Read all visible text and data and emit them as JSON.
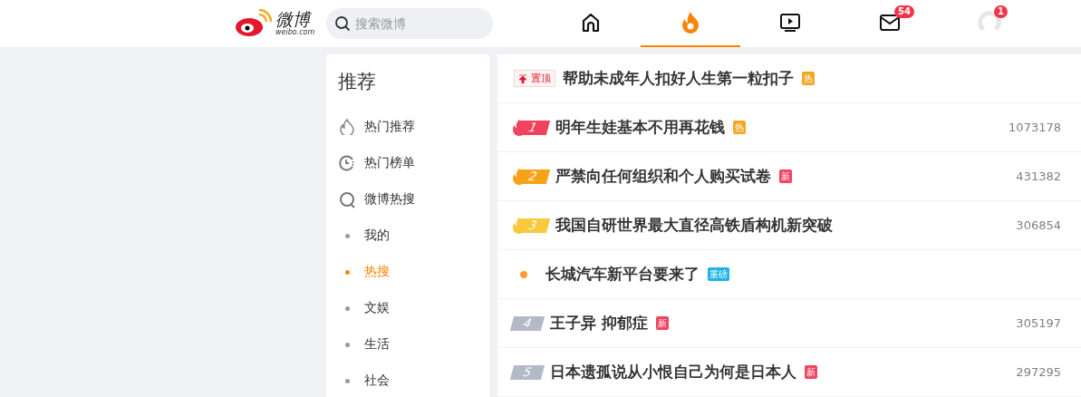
{
  "header": {
    "logo_name": "微博",
    "logo_text": "weibo.com",
    "search": {
      "placeholder": "搜索微博"
    },
    "tabs": [
      {
        "selected": false
      },
      {
        "selected": true
      },
      {
        "selected": false
      },
      {
        "selected": false,
        "badge": "54"
      },
      {
        "selected": false,
        "badge": "1"
      }
    ]
  },
  "sidebar": {
    "title": "推荐",
    "items": [
      {
        "kind": "section",
        "label": "热门推荐",
        "selected": false
      },
      {
        "kind": "section",
        "label": "热门榜单",
        "selected": false
      },
      {
        "kind": "section",
        "label": "微博热搜",
        "selected": false
      },
      {
        "kind": "sub",
        "label": "我的",
        "selected": false
      },
      {
        "kind": "sub",
        "label": "热搜",
        "selected": true
      },
      {
        "kind": "sub",
        "label": "文娱",
        "selected": false
      },
      {
        "kind": "sub",
        "label": "生活",
        "selected": false
      },
      {
        "kind": "sub",
        "label": "社会",
        "selected": false
      }
    ]
  },
  "hot_list": [
    {
      "kind": "pinned",
      "badge": "置顶",
      "title": "帮助未成年人扣好人生第一粒扣子",
      "tag": {
        "text": "热",
        "color": "#f5a623"
      }
    },
    {
      "kind": "ranked",
      "rank": "1",
      "color": "#f0445e",
      "title": "明年生娃基本不用再花钱",
      "tag": {
        "text": "热",
        "color": "#f5a623"
      },
      "count": "1073178"
    },
    {
      "kind": "ranked",
      "rank": "2",
      "color": "#f7a21b",
      "title": "严禁向任何组织和个人购买试卷",
      "tag": {
        "text": "新",
        "color": "#f0445e"
      },
      "count": "431382"
    },
    {
      "kind": "ranked",
      "rank": "3",
      "color": "#f9c83c",
      "title": "我国自研世界最大直径高铁盾构机新突破",
      "count": "306854"
    },
    {
      "kind": "promo",
      "title": "长城汽车新平台要来了",
      "tag": {
        "text": "重磅",
        "color": "#1ab3e6"
      }
    },
    {
      "kind": "ranked",
      "rank": "4",
      "color": "#b4b9c8",
      "title": "王子异 抑郁症",
      "tag": {
        "text": "新",
        "color": "#f0445e"
      },
      "count": "305197"
    },
    {
      "kind": "ranked",
      "rank": "5",
      "color": "#b4b9c8",
      "title": "日本遗孤说从小恨自己为何是日本人",
      "tag": {
        "text": "新",
        "color": "#f0445e"
      },
      "count": "297295"
    }
  ]
}
